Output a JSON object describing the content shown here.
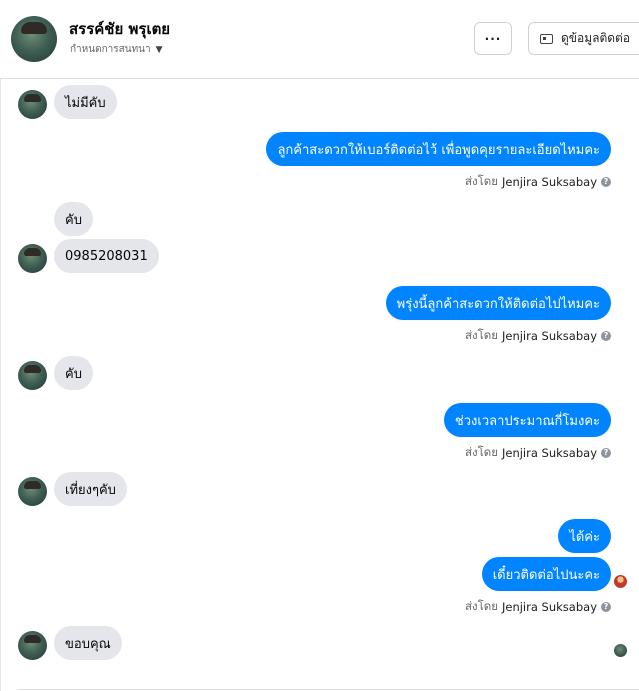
{
  "header": {
    "name": "สรรค์ชัย พรุเตย",
    "subtitle": "กำหนดการสนทนา",
    "more_label": "···",
    "contact_label": "ดูข้อมูลติดต่อ"
  },
  "messages": [
    {
      "text": "ไม่มีคับ"
    },
    {
      "text": "ลูกค้าสะดวกให้เบอร์ติดต่อไว้ เพื่อพูดคุยรายละเอียดไหมคะ"
    },
    {
      "text": "คับ"
    },
    {
      "text": "0985208031"
    },
    {
      "text": "พรุ่งนี้ลูกค้าสะดวกให้ติดต่อไปไหมคะ"
    },
    {
      "text": "คับ"
    },
    {
      "text": "ช่วงเวลาประมาณกี่โมงคะ"
    },
    {
      "text": "เที่ยงๆคับ"
    },
    {
      "text": "ได้ค่ะ"
    },
    {
      "text": "เดี๋ยวติดต่อไปนะคะ"
    },
    {
      "text": "ขอบคุณ"
    }
  ],
  "sent_by": {
    "prefix": "ส่งโดย",
    "agent": "Jenjira Suksabay",
    "help": "?"
  },
  "colors": {
    "outgoing_bubble": "#0084ff",
    "incoming_bubble": "#e4e6eb"
  }
}
